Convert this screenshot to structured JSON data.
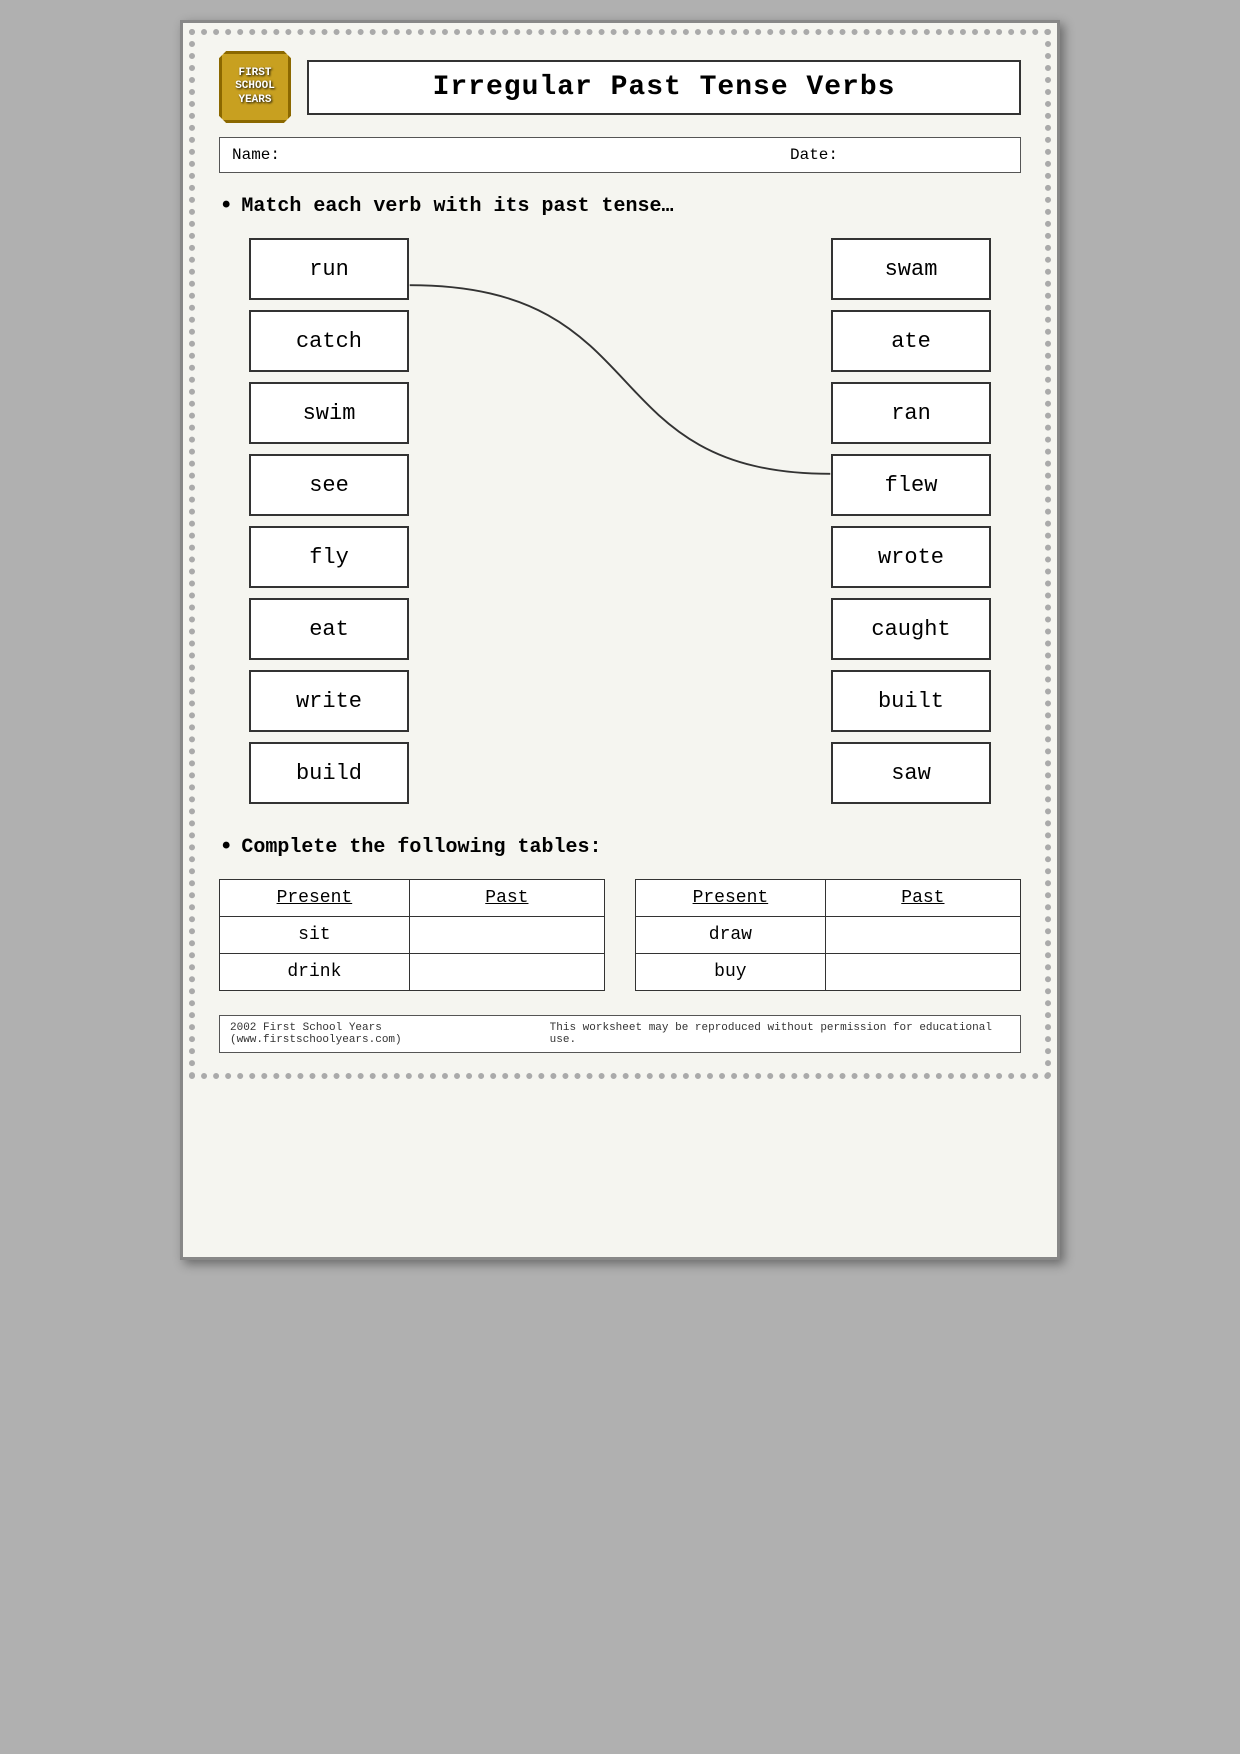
{
  "header": {
    "logo_line1": "FIRST",
    "logo_line2": "SCHOOL",
    "logo_line3": "YEARS",
    "title": "Irregular Past Tense Verbs"
  },
  "name_date": {
    "name_label": "Name:",
    "date_label": "Date:"
  },
  "section1": {
    "instruction": "Match each verb with its past tense…"
  },
  "left_words": [
    "run",
    "catch",
    "swim",
    "see",
    "fly",
    "eat",
    "write",
    "build"
  ],
  "right_words": [
    "swam",
    "ate",
    "ran",
    "flew",
    "wrote",
    "caught",
    "built",
    "saw"
  ],
  "section2": {
    "instruction": "Complete the following tables:"
  },
  "table1": {
    "col1_header": "Present",
    "col2_header": "Past",
    "rows": [
      {
        "present": "sit",
        "past": ""
      },
      {
        "present": "drink",
        "past": ""
      }
    ]
  },
  "table2": {
    "col1_header": "Present",
    "col2_header": "Past",
    "rows": [
      {
        "present": "draw",
        "past": ""
      },
      {
        "present": "buy",
        "past": ""
      }
    ]
  },
  "footer": {
    "left": "2002 First School Years  (www.firstschoolyears.com)",
    "right": "This worksheet may be reproduced without permission for educational use."
  }
}
